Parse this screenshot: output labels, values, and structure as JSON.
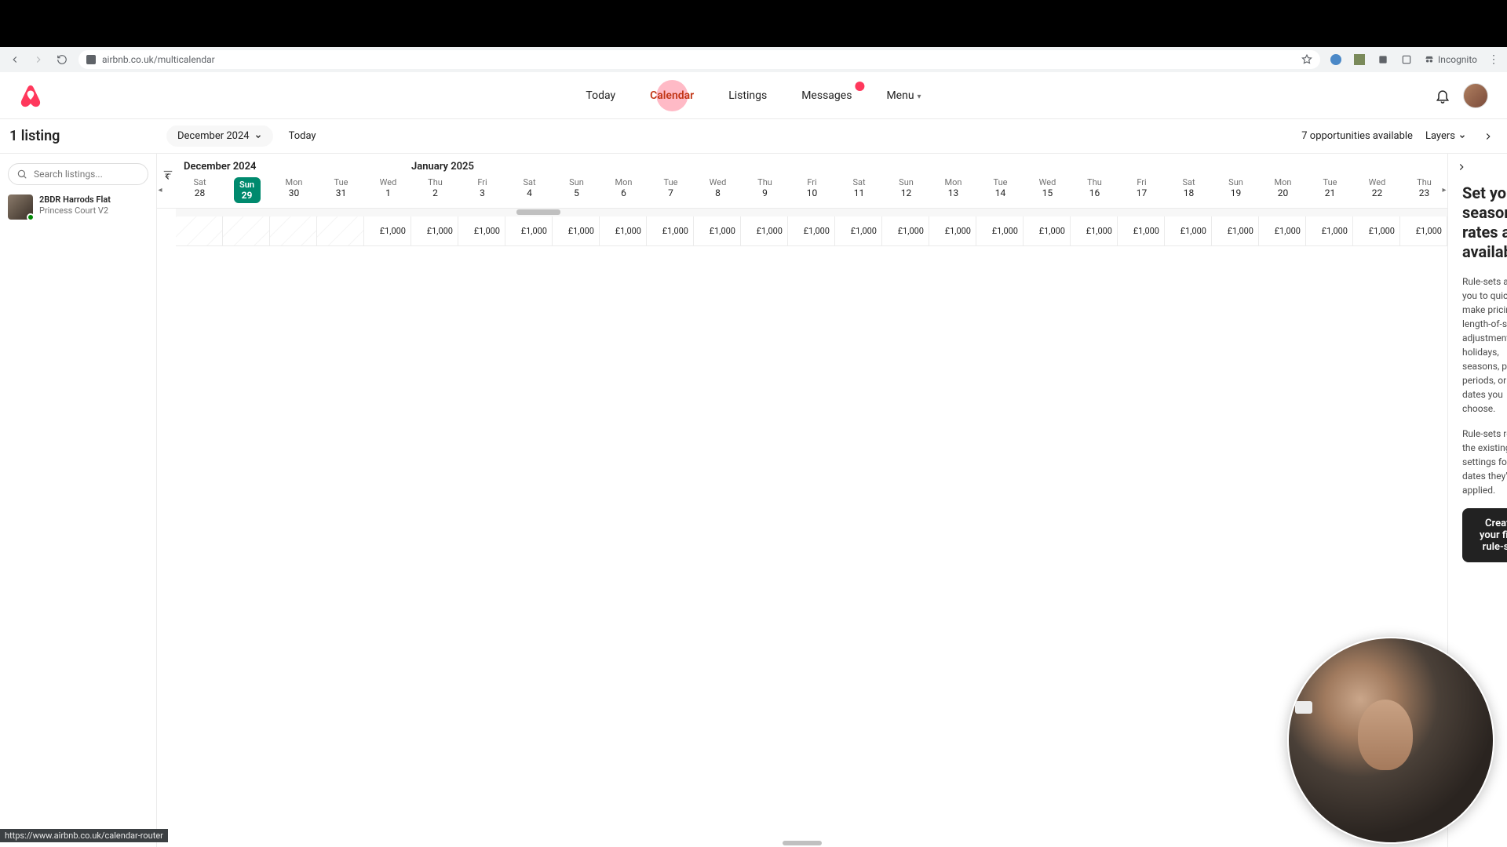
{
  "browser": {
    "url": "airbnb.co.uk/multicalendar",
    "incognito_label": "Incognito",
    "hover_url": "https://www.airbnb.co.uk/calendar-router"
  },
  "nav": {
    "items": [
      {
        "label": "Today"
      },
      {
        "label": "Calendar",
        "active": true
      },
      {
        "label": "Listings"
      },
      {
        "label": "Messages",
        "badge": true
      },
      {
        "label": "Menu",
        "chevron": true
      }
    ]
  },
  "subbar": {
    "month_label": "December 2024",
    "today_label": "Today",
    "opportunities": "7 opportunities available",
    "layers_label": "Layers"
  },
  "sidebar": {
    "heading": "1 listing",
    "search_placeholder": "Search listings...",
    "listing": {
      "title": "2BDR Harrods Flat",
      "subtitle": "Princess Court V2"
    }
  },
  "calendar": {
    "months": {
      "left": "December 2024",
      "right": "January 2025"
    },
    "days": [
      {
        "dow": "Sat",
        "num": "28",
        "price": "",
        "hatched": true
      },
      {
        "dow": "Sun",
        "num": "29",
        "price": "",
        "hatched": true,
        "today": true
      },
      {
        "dow": "Mon",
        "num": "30",
        "price": "",
        "hatched": true
      },
      {
        "dow": "Tue",
        "num": "31",
        "price": "",
        "hatched": true
      },
      {
        "dow": "Wed",
        "num": "1",
        "price": "£1,000"
      },
      {
        "dow": "Thu",
        "num": "2",
        "price": "£1,000"
      },
      {
        "dow": "Fri",
        "num": "3",
        "price": "£1,000"
      },
      {
        "dow": "Sat",
        "num": "4",
        "price": "£1,000"
      },
      {
        "dow": "Sun",
        "num": "5",
        "price": "£1,000"
      },
      {
        "dow": "Mon",
        "num": "6",
        "price": "£1,000"
      },
      {
        "dow": "Tue",
        "num": "7",
        "price": "£1,000"
      },
      {
        "dow": "Wed",
        "num": "8",
        "price": "£1,000"
      },
      {
        "dow": "Thu",
        "num": "9",
        "price": "£1,000"
      },
      {
        "dow": "Fri",
        "num": "10",
        "price": "£1,000"
      },
      {
        "dow": "Sat",
        "num": "11",
        "price": "£1,000"
      },
      {
        "dow": "Sun",
        "num": "12",
        "price": "£1,000"
      },
      {
        "dow": "Mon",
        "num": "13",
        "price": "£1,000"
      },
      {
        "dow": "Tue",
        "num": "14",
        "price": "£1,000"
      },
      {
        "dow": "Wed",
        "num": "15",
        "price": "£1,000"
      },
      {
        "dow": "Thu",
        "num": "16",
        "price": "£1,000"
      },
      {
        "dow": "Fri",
        "num": "17",
        "price": "£1,000"
      },
      {
        "dow": "Sat",
        "num": "18",
        "price": "£1,000"
      },
      {
        "dow": "Sun",
        "num": "19",
        "price": "£1,000"
      },
      {
        "dow": "Mon",
        "num": "20",
        "price": "£1,000"
      },
      {
        "dow": "Tue",
        "num": "21",
        "price": "£1,000"
      },
      {
        "dow": "Wed",
        "num": "22",
        "price": "£1,000"
      },
      {
        "dow": "Thu",
        "num": "23",
        "price": "£1,000"
      }
    ]
  },
  "panel": {
    "title": "Set your seasonal rates and availability",
    "p1": "Rule-sets allow you to quickly make pricing and length-of-stay adjustments for holidays, seasons, peak periods, or any dates you choose.",
    "p2": "Rule-sets replace the existing settings for the dates they're applied.",
    "button": "Create your first rule-set"
  }
}
